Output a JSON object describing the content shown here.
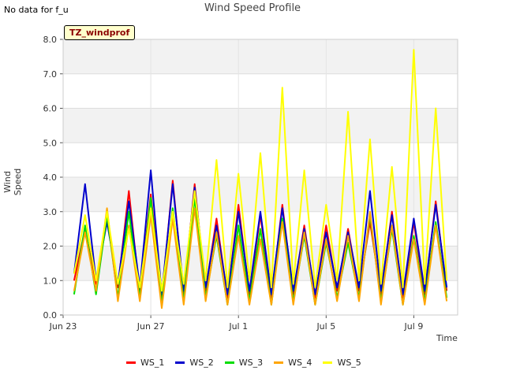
{
  "note": "No data for f_u",
  "badge": "TZ_windprof",
  "chart_data": {
    "type": "line",
    "title": "Wind Speed Profile",
    "xlabel": "Time",
    "ylabel": "Wind Speed",
    "ylim": [
      0,
      8
    ],
    "xlim": [
      "2016-06-23",
      "2016-07-11"
    ],
    "yticks": [
      "0.0",
      "1.0",
      "2.0",
      "3.0",
      "4.0",
      "5.0",
      "6.0",
      "7.0",
      "8.0"
    ],
    "xticks": [
      {
        "date": "2016-06-23",
        "label": "Jun 23"
      },
      {
        "date": "2016-06-27",
        "label": "Jun 27"
      },
      {
        "date": "2016-07-01",
        "label": "Jul 1"
      },
      {
        "date": "2016-07-05",
        "label": "Jul 5"
      },
      {
        "date": "2016-07-09",
        "label": "Jul 9"
      }
    ],
    "grid": true,
    "legend_position": "bottom",
    "x": [
      "2016-06-23T12:00",
      "2016-06-24T00:00",
      "2016-06-24T12:00",
      "2016-06-25T00:00",
      "2016-06-25T12:00",
      "2016-06-26T00:00",
      "2016-06-26T12:00",
      "2016-06-27T00:00",
      "2016-06-27T12:00",
      "2016-06-28T00:00",
      "2016-06-28T12:00",
      "2016-06-29T00:00",
      "2016-06-29T12:00",
      "2016-06-30T00:00",
      "2016-06-30T12:00",
      "2016-07-01T00:00",
      "2016-07-01T12:00",
      "2016-07-02T00:00",
      "2016-07-02T12:00",
      "2016-07-03T00:00",
      "2016-07-03T12:00",
      "2016-07-04T00:00",
      "2016-07-04T12:00",
      "2016-07-05T00:00",
      "2016-07-05T12:00",
      "2016-07-06T00:00",
      "2016-07-06T12:00",
      "2016-07-07T00:00",
      "2016-07-07T12:00",
      "2016-07-08T00:00",
      "2016-07-08T12:00",
      "2016-07-09T00:00",
      "2016-07-09T12:00",
      "2016-07-10T00:00",
      "2016-07-10T12:00"
    ],
    "series": [
      {
        "name": "WS_1",
        "color": "#ff0000",
        "values": [
          1.0,
          2.5,
          0.9,
          2.8,
          0.8,
          3.6,
          0.6,
          3.5,
          0.5,
          3.9,
          0.6,
          3.8,
          0.7,
          2.8,
          0.5,
          3.2,
          0.6,
          2.9,
          0.5,
          3.2,
          0.6,
          2.6,
          0.5,
          2.6,
          0.7,
          2.5,
          0.7,
          2.7,
          0.6,
          3.0,
          0.5,
          2.7,
          0.6,
          3.3,
          0.7
        ]
      },
      {
        "name": "WS_2",
        "color": "#0000cc",
        "values": [
          1.2,
          3.8,
          1.0,
          2.7,
          0.9,
          3.3,
          0.8,
          4.2,
          0.6,
          3.8,
          0.7,
          3.7,
          0.8,
          2.6,
          0.6,
          3.0,
          0.7,
          3.0,
          0.6,
          3.1,
          0.7,
          2.5,
          0.6,
          2.4,
          0.8,
          2.4,
          0.8,
          3.6,
          0.7,
          2.9,
          0.6,
          2.8,
          0.7,
          3.2,
          0.8
        ]
      },
      {
        "name": "WS_3",
        "color": "#00dd00",
        "values": [
          0.6,
          2.6,
          0.6,
          2.9,
          0.5,
          3.0,
          0.5,
          3.4,
          0.3,
          3.1,
          0.4,
          3.4,
          0.5,
          2.3,
          0.3,
          2.6,
          0.4,
          2.5,
          0.3,
          2.8,
          0.4,
          2.3,
          0.3,
          2.1,
          0.5,
          2.1,
          0.5,
          2.9,
          0.4,
          2.5,
          0.3,
          2.3,
          0.4,
          2.7,
          0.5
        ]
      },
      {
        "name": "WS_4",
        "color": "#ffa500",
        "values": [
          0.7,
          2.4,
          0.7,
          3.1,
          0.4,
          2.6,
          0.4,
          2.9,
          0.2,
          2.8,
          0.3,
          3.1,
          0.4,
          2.4,
          0.3,
          2.3,
          0.3,
          2.2,
          0.3,
          2.7,
          0.3,
          2.4,
          0.3,
          2.2,
          0.4,
          2.3,
          0.4,
          3.0,
          0.3,
          2.6,
          0.3,
          2.2,
          0.3,
          2.6,
          0.4
        ]
      },
      {
        "name": "WS_5",
        "color": "#ffff00",
        "values": [
          1.2,
          2.9,
          1.0,
          3.0,
          0.9,
          2.5,
          0.8,
          3.1,
          0.7,
          3.0,
          0.9,
          3.6,
          1.0,
          4.5,
          0.8,
          4.1,
          1.0,
          4.7,
          0.8,
          6.6,
          0.9,
          4.2,
          0.8,
          3.2,
          1.0,
          5.9,
          1.0,
          5.1,
          0.9,
          4.3,
          0.8,
          7.7,
          0.9,
          6.0,
          1.0
        ]
      }
    ]
  }
}
